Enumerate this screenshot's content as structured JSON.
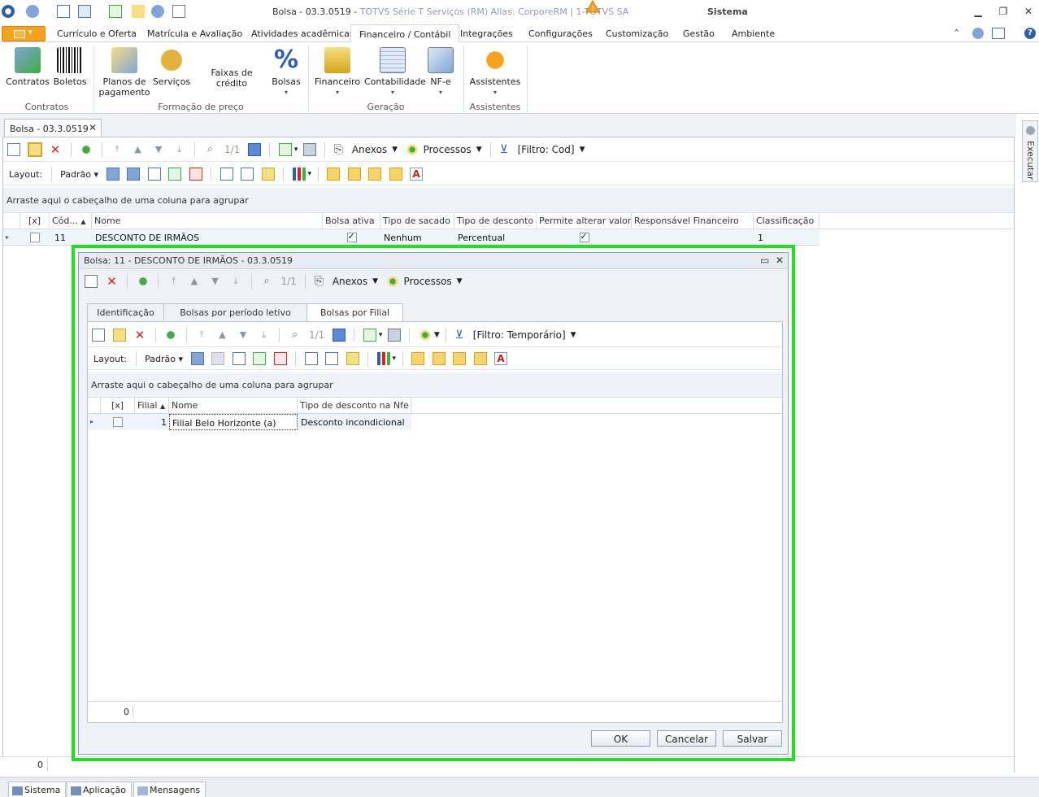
{
  "titlebar": {
    "title": "Bolsa - 03.3.0519",
    "subtitle": "TOTVS Série T Serviços (RM) Alias: CorporeRM | 1-TOTVS SA",
    "module": "Sistema"
  },
  "menu": {
    "tabs": [
      "Currículo e Oferta",
      "Matrícula e Avaliação",
      "Atividades acadêmicas",
      "Financeiro / Contábil",
      "Integrações",
      "Configurações",
      "Customização",
      "Gestão",
      "Ambiente"
    ],
    "active": "Financeiro / Contábil"
  },
  "ribbon": {
    "contratos": "Contratos",
    "boletos": "Boletos",
    "planos_l1": "Planos de",
    "planos_l2": "pagamento",
    "servicos": "Serviços",
    "faixas": "Faixas de crédito",
    "bolsas": "Bolsas",
    "financeiro": "Financeiro",
    "contabilidade": "Contabilidade",
    "nfe": "NF-e",
    "assistentes": "Assistentes",
    "groups": {
      "contratos": "Contratos",
      "formacao": "Formação de preço",
      "geracao": "Geração",
      "assistentes": "Assistentes"
    }
  },
  "doctab": {
    "label": "Bolsa - 03.3.0519"
  },
  "main": {
    "paging": "1/1",
    "anexos": "Anexos",
    "processos": "Processos",
    "filtro": "[Filtro: Cod]",
    "layout_label": "Layout:",
    "layout_value": "Padrão",
    "group_hint": "Arraste aqui o cabeçalho de uma coluna para agrupar",
    "columns": [
      "[x]",
      "Cód...",
      "Nome",
      "Bolsa ativa",
      "Tipo de sacado",
      "Tipo de desconto",
      "Permite alterar valor",
      "Responsável Financeiro",
      "Classificação"
    ],
    "row": {
      "cod": "11",
      "nome": "DESCONTO DE IRMÃOS",
      "bolsa_ativa": true,
      "tipo_sacado": "Nenhum",
      "tipo_desconto": "Percentual",
      "permite_alterar": true,
      "responsavel": "",
      "classificacao": "1"
    },
    "status_count": "0"
  },
  "dialog": {
    "title": "Bolsa: 11 - DESCONTO DE IRMÃOS - 03.3.0519",
    "paging": "1/1",
    "anexos": "Anexos",
    "processos": "Processos",
    "tabs": [
      "Identificação",
      "Bolsas por período letivo",
      "Bolsas por Filial"
    ],
    "active_tab": "Bolsas por Filial",
    "inner": {
      "paging": "1/1",
      "filtro": "[Filtro: Temporário]",
      "layout_label": "Layout:",
      "layout_value": "Padrão",
      "group_hint": "Arraste aqui o cabeçalho de uma coluna para agrupar",
      "columns": [
        "[x]",
        "Filial",
        "Nome",
        "Tipo de desconto na Nfe"
      ],
      "row": {
        "filial": "1",
        "nome": "Filial Belo Horizonte (a)",
        "tipo": "Desconto incondicional"
      },
      "status_count": "0"
    },
    "buttons": {
      "ok": "OK",
      "cancel": "Cancelar",
      "save": "Salvar"
    }
  },
  "side": {
    "executar": "Executar"
  },
  "bottom": {
    "sistema": "Sistema",
    "aplicacao": "Aplicação",
    "mensagens": "Mensagens"
  },
  "colors": {
    "accent": "#f6a21d",
    "highlight": "#1ee21e"
  }
}
